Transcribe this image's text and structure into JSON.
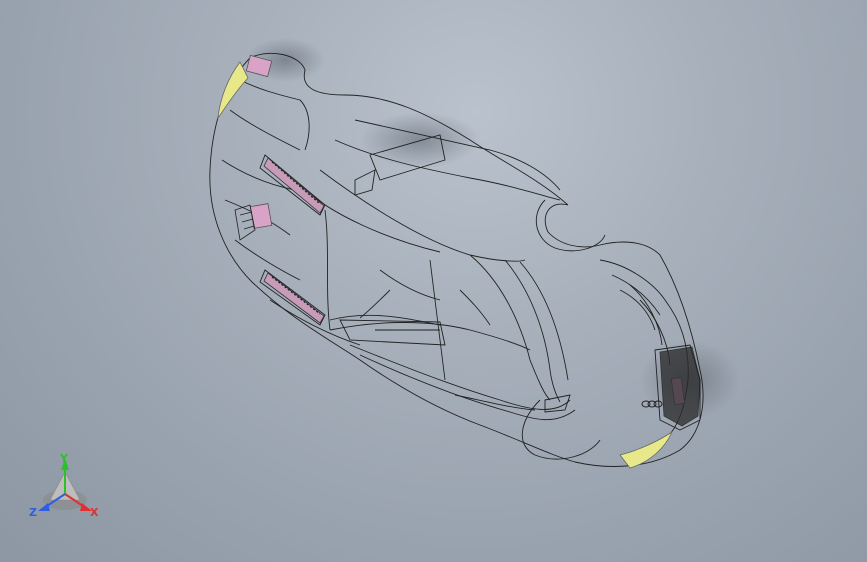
{
  "view": {
    "background_top": "#b9c2cd",
    "background_bottom": "#8d97a4",
    "wireframe_color": "#1c1c1c",
    "highlight_pink": "#d9a3c8",
    "highlight_yellow": "#e6e88a"
  },
  "model": {
    "badge_text": "",
    "edge_color": "#222222"
  },
  "triad": {
    "y_label": "Y",
    "x_label": "X",
    "z_label": "Z",
    "y_color": "#2dbf2d",
    "x_color": "#e03030",
    "z_color": "#2f5fe0"
  }
}
